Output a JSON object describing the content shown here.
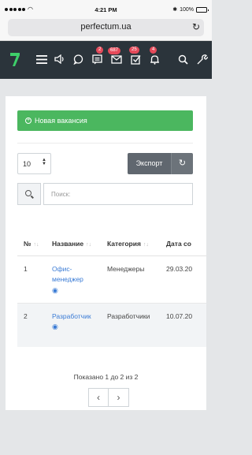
{
  "status_bar": {
    "time": "4:21 PM",
    "battery": "100%"
  },
  "browser": {
    "url": "perfectum.ua"
  },
  "navbar": {
    "badges": {
      "tasks": "2",
      "mail": "687",
      "check": "25",
      "bell": "4"
    }
  },
  "actions": {
    "new_vacancy": "Новая вакансия",
    "page_size": "10",
    "export": "Экспорт",
    "search_placeholder": "Поиск:"
  },
  "table": {
    "headers": [
      "№",
      "Название",
      "Категория",
      "Дата со"
    ],
    "rows": [
      {
        "num": "1",
        "title_line1": "Офис-",
        "title_line2": "менеджер",
        "category": "Менеджеры",
        "date": "29.03.20"
      },
      {
        "num": "2",
        "title_line1": "Разработчик",
        "category": "Разработчики",
        "date": "10.07.20"
      }
    ]
  },
  "pagination": {
    "info": "Показано 1 до 2 из 2",
    "prev": "‹",
    "next": "›"
  }
}
